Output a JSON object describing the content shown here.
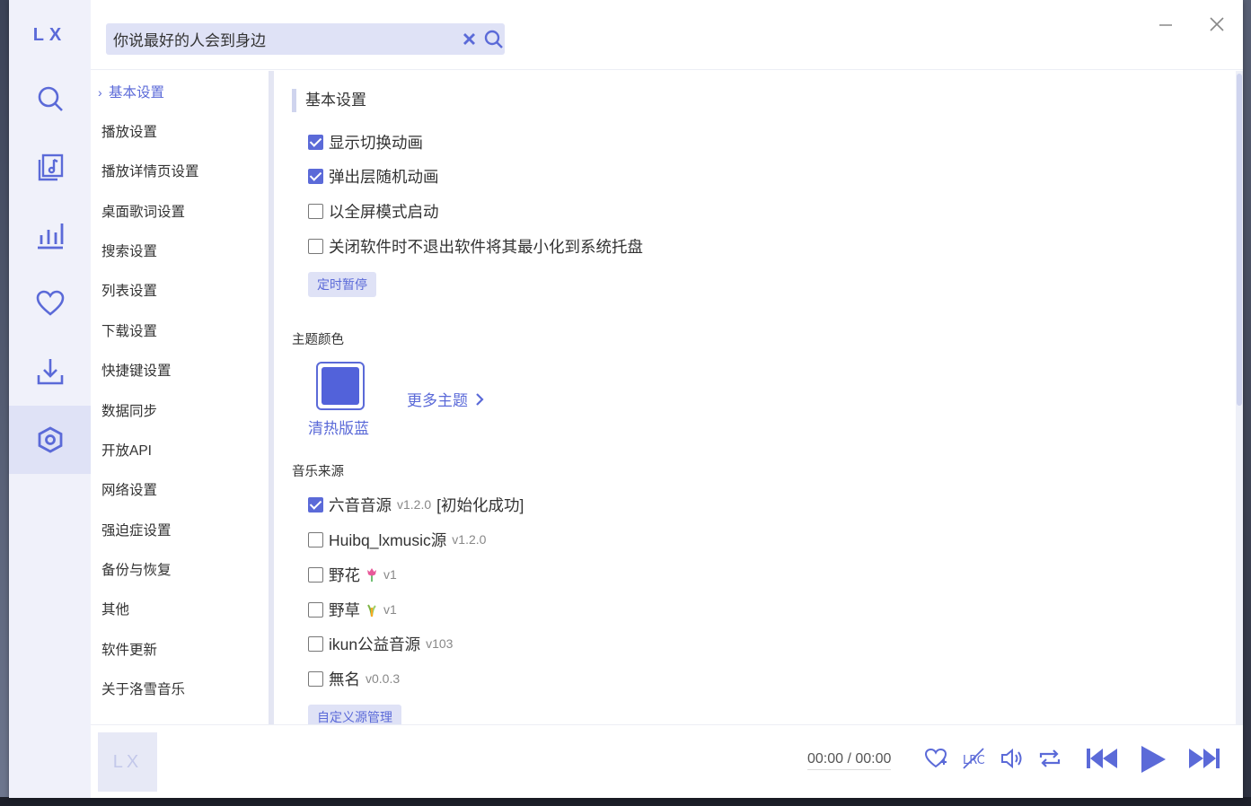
{
  "app": {
    "logo": "LX"
  },
  "search": {
    "value": "你说最好的人会到身边"
  },
  "rail": {
    "items": [
      {
        "icon": "search-icon"
      },
      {
        "icon": "music-library-icon"
      },
      {
        "icon": "leaderboard-icon"
      },
      {
        "icon": "heart-icon"
      },
      {
        "icon": "download-icon"
      },
      {
        "icon": "settings-icon",
        "active": true
      }
    ]
  },
  "settings_nav": {
    "items": [
      "基本设置",
      "播放设置",
      "播放详情页设置",
      "桌面歌词设置",
      "搜索设置",
      "列表设置",
      "下载设置",
      "快捷键设置",
      "数据同步",
      "开放API",
      "网络设置",
      "强迫症设置",
      "备份与恢复",
      "其他",
      "软件更新",
      "关于洛雪音乐"
    ],
    "active_index": 0
  },
  "basic": {
    "title": "基本设置",
    "options": [
      {
        "label": "显示切换动画",
        "checked": true
      },
      {
        "label": "弹出层随机动画",
        "checked": true
      },
      {
        "label": "以全屏模式启动",
        "checked": false
      },
      {
        "label": "关闭软件时不退出软件将其最小化到系统托盘",
        "checked": false
      }
    ],
    "timer_button": "定时暂停"
  },
  "theme": {
    "label": "主题颜色",
    "current_name": "清热版蓝",
    "current_color": "#5262da",
    "more": "更多主题"
  },
  "sources": {
    "label": "音乐来源",
    "items": [
      {
        "name": "六音音源",
        "version": "v1.2.0",
        "status": "[初始化成功]",
        "checked": true
      },
      {
        "name": "Huibq_lxmusic源",
        "version": "v1.2.0",
        "status": "",
        "checked": false
      },
      {
        "name": "野花",
        "emoji": "tulip-icon",
        "version": "v1",
        "status": "",
        "checked": false
      },
      {
        "name": "野草",
        "emoji": "grass-icon",
        "version": "v1",
        "status": "",
        "checked": false
      },
      {
        "name": "ikun公益音源",
        "version": "v103",
        "status": "",
        "checked": false
      },
      {
        "name": "無名",
        "version": "v0.0.3",
        "status": "",
        "checked": false
      }
    ],
    "manage_button": "自定义源管理"
  },
  "player": {
    "cover_text": "LX",
    "time": "00:00 / 00:00"
  },
  "colors": {
    "accent": "#5b6ad8",
    "accent_light": "#dfe2f6"
  }
}
